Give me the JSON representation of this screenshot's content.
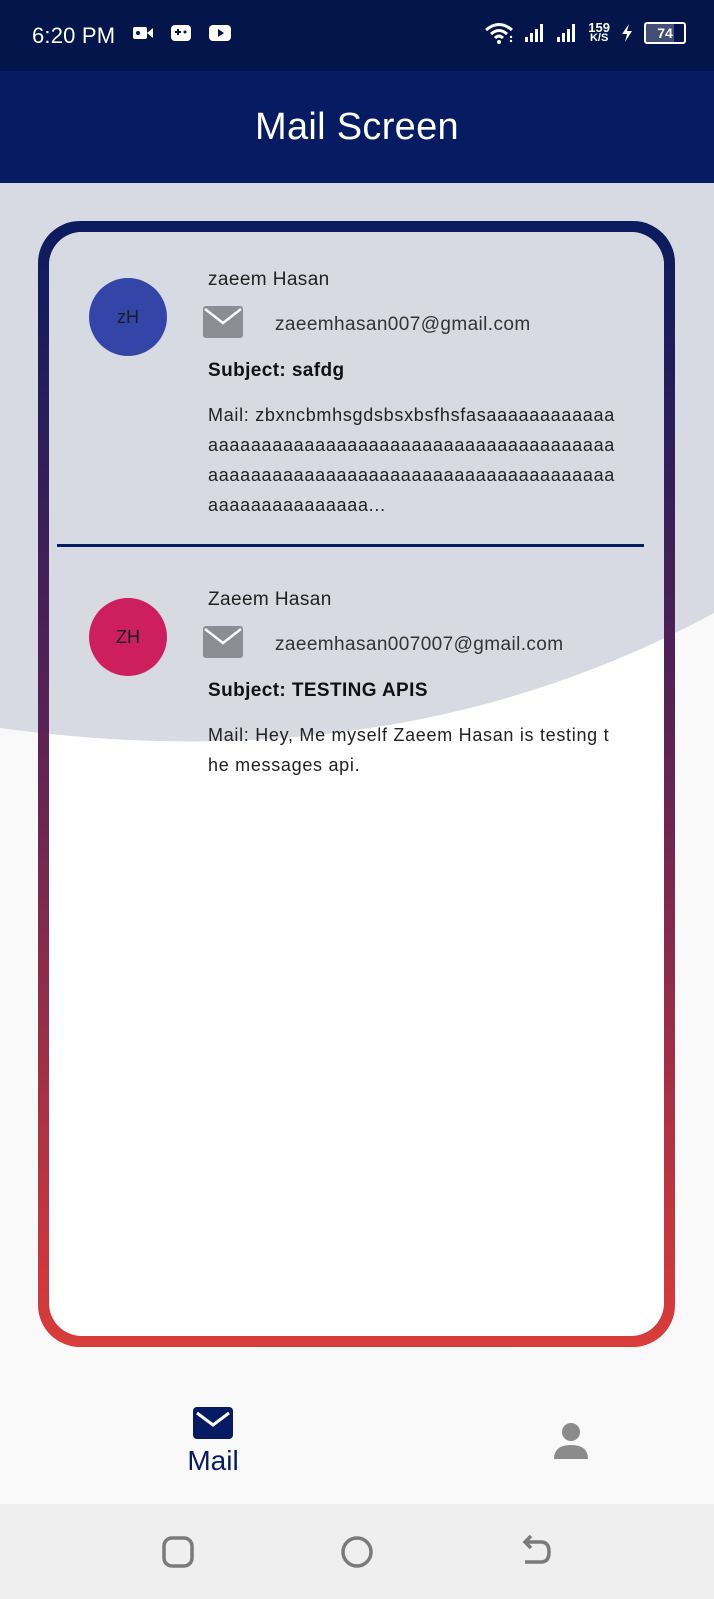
{
  "status_bar": {
    "time": "6:20 PM",
    "left_icons": [
      "video-camera-icon",
      "gamepad-icon",
      "youtube-icon"
    ],
    "network_speed_value": "159",
    "network_speed_unit": "K/S",
    "battery_level": "74"
  },
  "app_bar": {
    "title": "Mail Screen"
  },
  "mails": [
    {
      "initials": "zH",
      "avatar_color": "#3346a8",
      "sender": "zaeem Hasan",
      "email": "zaeemhasan007@gmail.com",
      "subject": "Subject: safdg",
      "body": "Mail: zbxncbmhsgdsbsxbsfhsfasaaaaaaaaaaaaaaaaaaaaaaaaaaaaaaaaaaaaaaaaaaaaaaaaaaaaaaaaaaaaaaaaaaaaaaaaaaaaaaaaaaaaaaaaaaaaaaaaaaaaaaa..."
    },
    {
      "initials": "ZH",
      "avatar_color": "#cd1f5e",
      "sender": "Zaeem Hasan",
      "email": "zaeemhasan007007@gmail.com",
      "subject": "Subject: TESTING APIS",
      "body": "Mail: Hey, Me myself Zaeem Hasan is testing the messages api."
    }
  ],
  "bottom_nav": {
    "mail_label": "Mail",
    "profile_icon": "person-icon"
  },
  "colors": {
    "primary": "#061b62",
    "curve_bg": "#d7d9e3",
    "gradient_top": "#0b1b5d",
    "gradient_bottom": "#d93c3b"
  }
}
